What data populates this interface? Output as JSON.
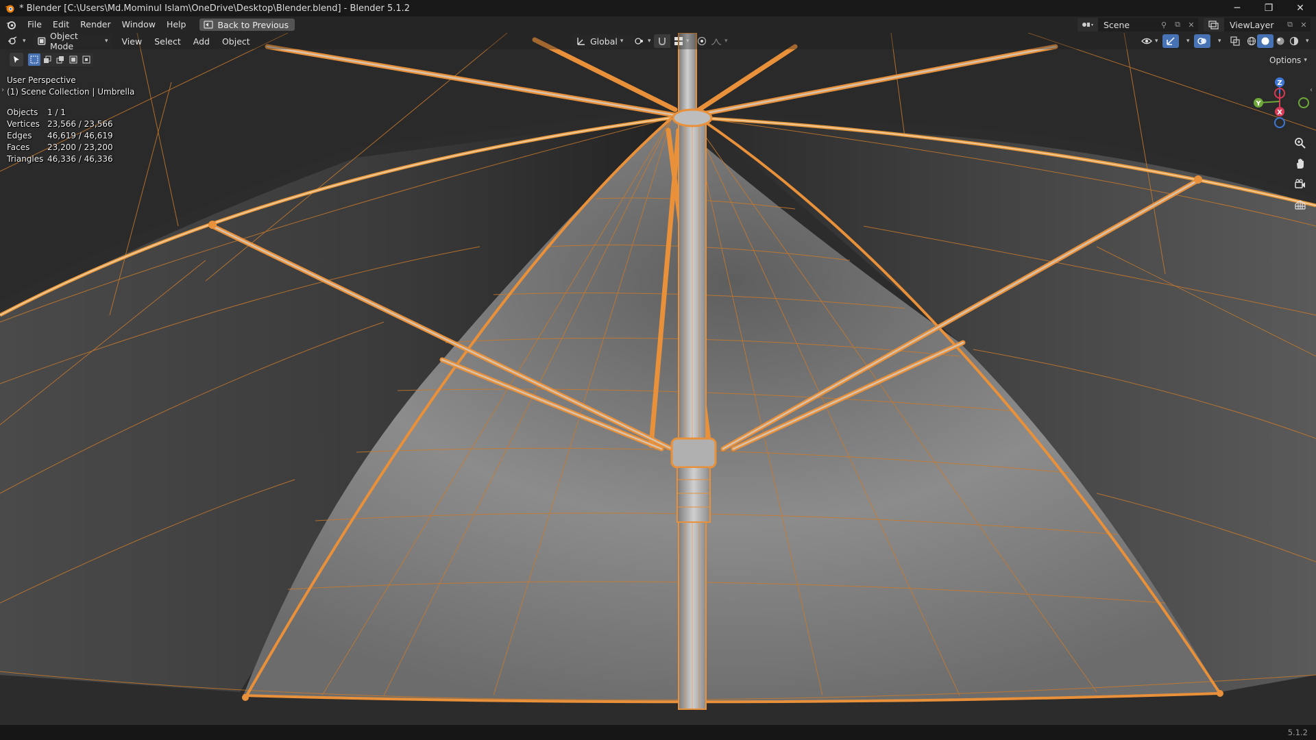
{
  "window": {
    "title": "* Blender [C:\\Users\\Md.Mominul Islam\\OneDrive\\Desktop\\Blender.blend] - Blender 5.1.2",
    "minimize": "─",
    "restore": "❐",
    "close": "✕"
  },
  "menubar": {
    "items": [
      "File",
      "Edit",
      "Render",
      "Window",
      "Help"
    ],
    "back_label": "Back to Previous",
    "scene_name": "Scene",
    "view_layer_name": "ViewLayer"
  },
  "viewport_header": {
    "mode_label": "Object Mode",
    "menus": [
      "View",
      "Select",
      "Add",
      "Object"
    ],
    "orientation_label": "Global"
  },
  "overlay": {
    "perspective": "User Perspective",
    "collection": "(1) Scene Collection | Umbrella",
    "stats": [
      {
        "label": "Objects",
        "value": "1 / 1"
      },
      {
        "label": "Vertices",
        "value": "23,566 / 23,566"
      },
      {
        "label": "Edges",
        "value": "46,619 / 46,619"
      },
      {
        "label": "Faces",
        "value": "23,200 / 23,200"
      },
      {
        "label": "Triangles",
        "value": "46,336 / 46,336"
      }
    ]
  },
  "options_label": "Options",
  "gizmo": {
    "z": "Z",
    "y": "Y",
    "x": "X"
  },
  "colors": {
    "wire": "#e8903a",
    "accent": "#4772b3",
    "axis_x": "#d83a56",
    "axis_y": "#6ea93a",
    "axis_z": "#3f77d6"
  },
  "icons": [
    "blender-logo-icon",
    "editor-type-icon",
    "back-icon",
    "scene-icon",
    "pin-icon",
    "new-scene-icon",
    "close-small-icon",
    "view-layer-icon",
    "new-layer-icon",
    "object-mode-icon",
    "orientation-icon",
    "pivot-icon",
    "snap-icon",
    "snap-increment-icon",
    "proportional-icon",
    "falloff-icon",
    "visibility-icon",
    "gizmo-toggle-icon",
    "overlay-icon",
    "xray-icon",
    "wireframe-shading-icon",
    "solid-shading-icon",
    "material-shading-icon",
    "rendered-shading-icon",
    "zoom-icon",
    "pan-icon",
    "camera-view-icon",
    "ortho-grid-icon"
  ],
  "status": {
    "version": "5.1.2"
  }
}
